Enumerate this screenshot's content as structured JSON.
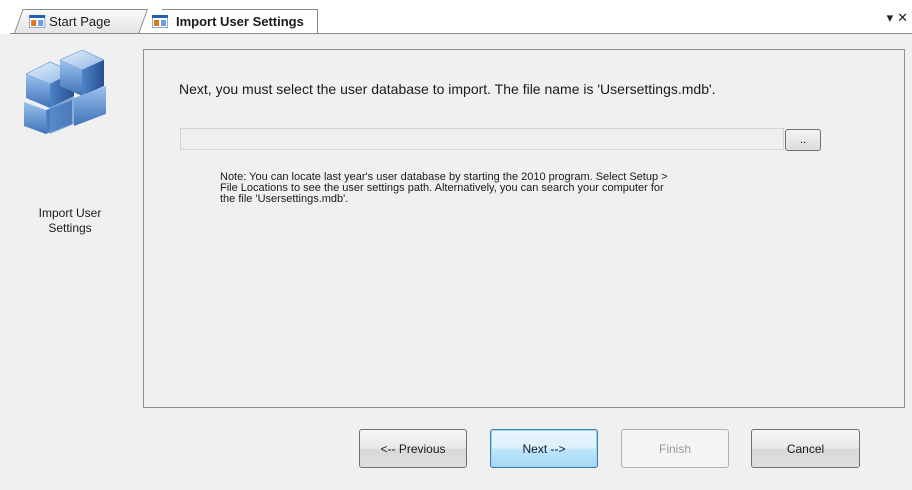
{
  "tabs": [
    {
      "label": "Start Page",
      "active": false,
      "icon": "window-app-icon"
    },
    {
      "label": "Import User Settings",
      "active": true,
      "icon": "window-app-icon"
    }
  ],
  "tab_controls": {
    "dropdown": "▾",
    "close": "✕"
  },
  "sidebar": {
    "icon": "cubes-icon",
    "label_line1": "Import User",
    "label_line2": "Settings"
  },
  "main": {
    "instruction": "Next, you must select the user database to import. The file name is 'Usersettings.mdb'.",
    "path_value": "",
    "browse_label": "..",
    "note_lines": [
      "Note: You can locate last year's user database by starting the 2010 program. Select Setup >",
      "File Locations to see the user settings path. Alternatively, you can search your computer for",
      "the file 'Usersettings.mdb'."
    ]
  },
  "buttons": {
    "previous": "<-- Previous",
    "next": "Next -->",
    "finish": "Finish",
    "cancel": "Cancel"
  },
  "colors": {
    "accent": "#3c7fb1",
    "cube": "#6f9ed6"
  }
}
